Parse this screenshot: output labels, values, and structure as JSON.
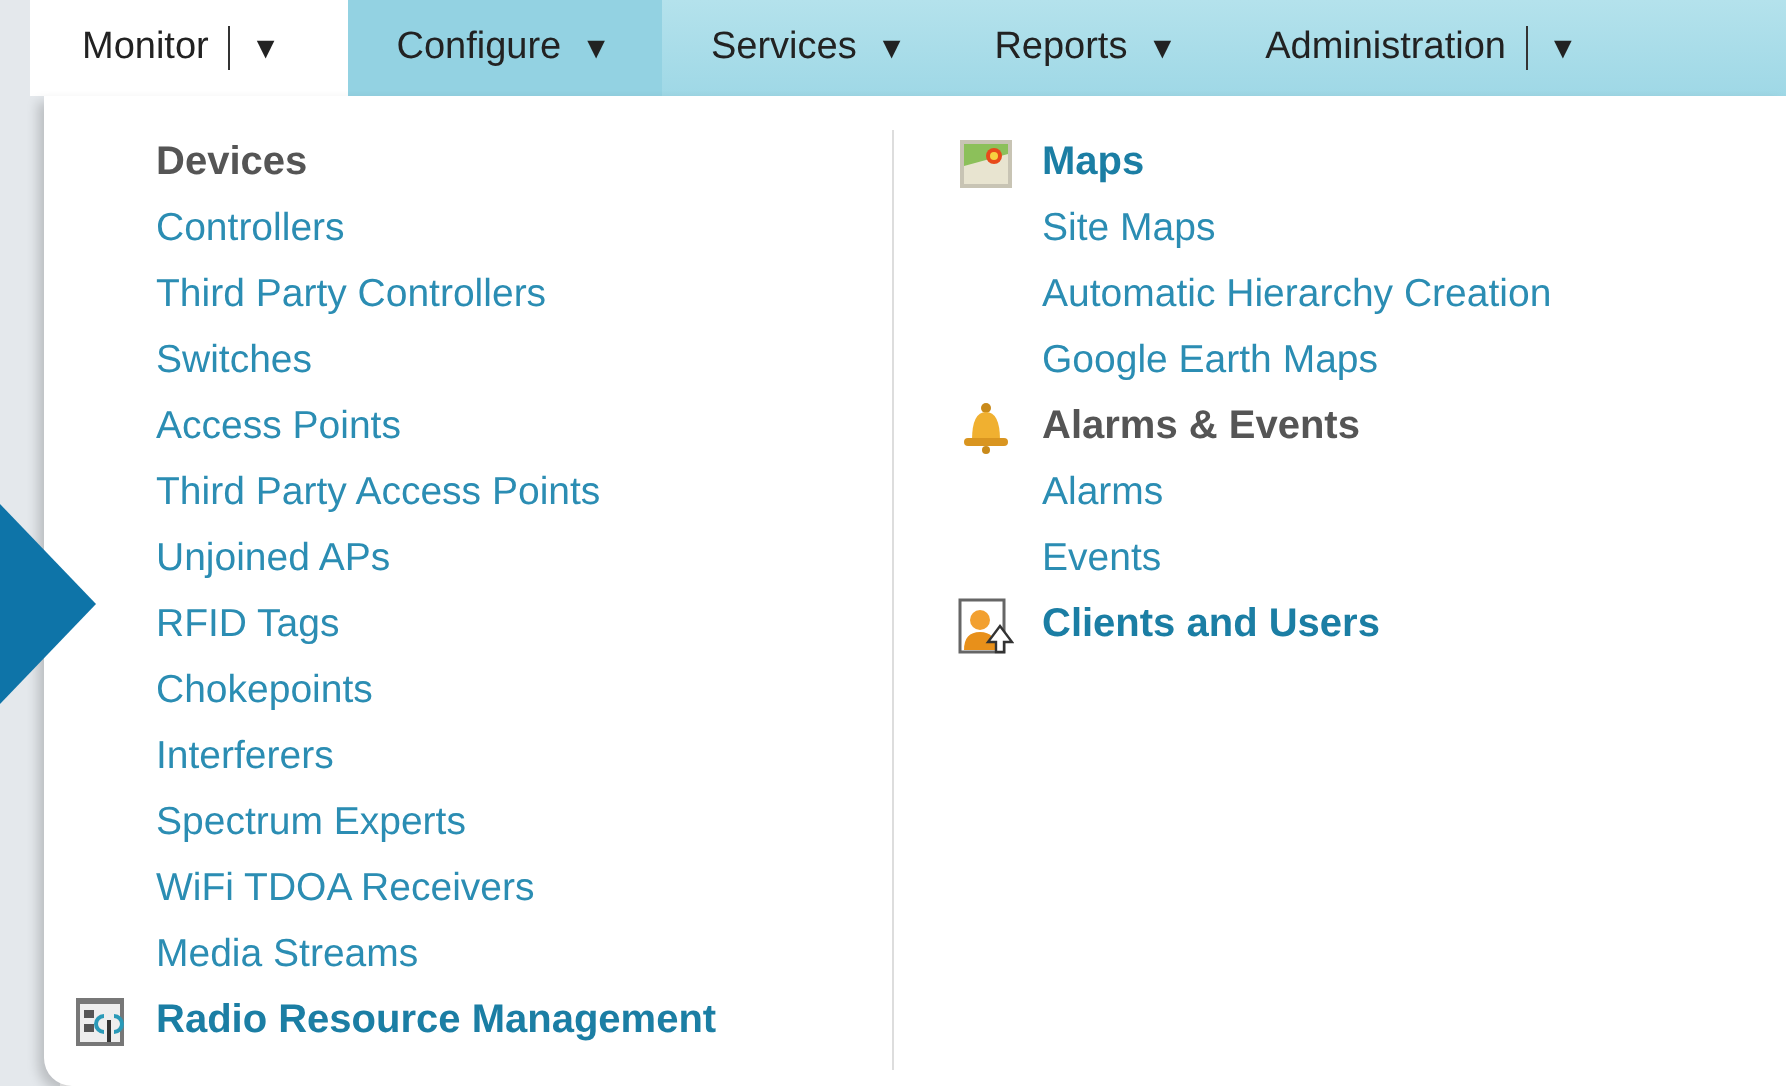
{
  "nav_tabs": [
    {
      "label": "Monitor",
      "caret": "▼",
      "split": true,
      "selected": true
    },
    {
      "label": "Configure",
      "caret": "▼",
      "split": false,
      "selected": false
    },
    {
      "label": "Services",
      "caret": "▼",
      "split": false,
      "selected": false
    },
    {
      "label": "Reports",
      "caret": "▼",
      "split": false,
      "selected": false
    },
    {
      "label": "Administration",
      "caret": "▼",
      "split": true,
      "selected": false
    }
  ],
  "menu": {
    "columns": [
      {
        "sections": [
          {
            "heading": "Devices",
            "kind": "group",
            "items": [
              "Controllers",
              "Third Party Controllers",
              "Switches",
              "Access Points",
              "Third Party Access Points",
              "Unjoined APs",
              "RFID Tags",
              "Chokepoints",
              "Interferers",
              "Spectrum Experts",
              "WiFi TDOA Receivers",
              "Media Streams"
            ]
          },
          {
            "heading": "Radio Resource Management",
            "kind": "link"
          }
        ]
      },
      {
        "sections": [
          {
            "heading": "Maps",
            "kind": "link",
            "items": [
              "Site Maps",
              "Automatic Hierarchy Creation",
              "Google Earth Maps"
            ]
          },
          {
            "heading": "Alarms & Events",
            "kind": "group",
            "items": [
              "Alarms",
              "Events"
            ]
          },
          {
            "heading": "Clients and Users",
            "kind": "link"
          }
        ]
      }
    ]
  }
}
